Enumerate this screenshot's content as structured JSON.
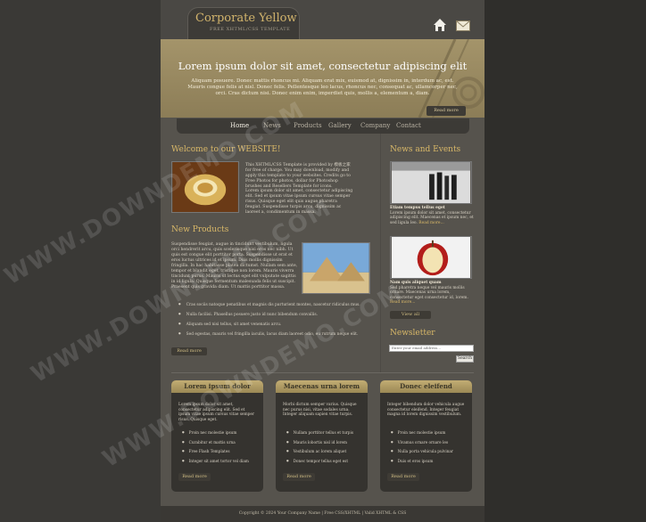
{
  "header": {
    "logo_title": "Corporate Yellow",
    "logo_subtitle": "FREE XHTML/CSS TEMPLATE"
  },
  "hero": {
    "title": "Lorem ipsum dolor sit amet, consectetur adipiscing elit",
    "text": "Aliquam posuere. Donec mattis rhoncus mi. Aliquam erat mix, euismod at, dignissim in, interdum ac, est. Mauris congue felis at nisl. Donec felis. Pellentesque leo lacus, rhoncus nec, consequat ac, ullamcorper nec, orci. Cras dictum nisi. Donec enim enim, imperdiet quis, mollis a, elementum a, diam.",
    "button": "Read more"
  },
  "nav": {
    "items": [
      "Home",
      "News",
      "Products",
      "Gallery",
      "Company",
      "Contact"
    ]
  },
  "welcome": {
    "heading": "Welcome to our WEBSITE!",
    "text": "This XHTML/CSS Template is provided by 模板之家 for free of charge. You may download, modify and apply this template to your websites. Credits go to Free Photos for photos, dollar for Photoshop brushes and Resellers Template for icons.",
    "text2": "Lorem ipsum dolor sit amet, consectetur adipiscing elit. Sed et ipsum vitae ipsum cursus vitae semper risus. Quisque eget elit quis augue pharetra feugiat. Suspendisse turpis arcu, dignissim ac laoreet a, condimentum in massa."
  },
  "products": {
    "heading": "New Products",
    "text": "Suspendisse feugiat, augue in tincidunt vestibulum, ligula orci hendrerit arcu, quis scelerisque nisi eros nec nibh. Ut quis est congue elit porttitor porta. Suspendisse ut erat et eros luctus ultrices id et ipsum. Duis mollis dignissim fringilla. In hac habitasse platea dictumst. Nullam sem ante, tempor et blandit eget, tristique non lorem. Mauris viverra tincidunt purus. Mauris ut lectus eget elit vulputate sagittis in id ligula. Quisque fermentum malesuada felis ut suscipit. Praesent quis gravida diam. Ut mattis porttitor massa.",
    "bullets": [
      "Cras sociis natoque penatibus et magnis dis parturient montes, nascetur ridiculus mus.",
      "Nulla facilisi. Phasellus posuere justo id nunc bibendum convallis.",
      "Aliquam sed nisi tellus, sit amet venenatis arcu.",
      "Sed egestas, mauris vel fringilla iaculis, lacus diam laoreet odio, eu rutrum neque elit."
    ],
    "button": "Read more"
  },
  "news": {
    "heading": "News and Events",
    "item1_title": "Etiam tempus tellus eget",
    "item1_text": "Lorem ipsum dolor sit amet, consectetur adipiscing elit. Maecenas et ipsum nec, et sed ligula leo.",
    "item1_link": "Read more...",
    "item2_title": "Nam quis aliquet quam",
    "item2_text": "Sed pharetra neque vel mauris mollis ornare. Maecenas urna lorem, consectetur eget consectetur id, lorem.",
    "item2_link": "Read more...",
    "view_all": "View all"
  },
  "newsletter": {
    "heading": "Newsletter",
    "placeholder": "Enter your email address...",
    "button": "Search"
  },
  "boxes": [
    {
      "title": "Lorem ipsum dolor",
      "text": "Lorem ipsum dolor sit amet, consectetur adipiscing elit. Sed et ipsum vitae ipsum cursus vitae semper risus. Quisque eget.",
      "items": [
        "Proin nec molestie ipsum",
        "Curabitur et mattis urna",
        "Free Flash Templates",
        "Integer sit amet tortor vel diam"
      ],
      "button": "Read more"
    },
    {
      "title": "Maecenas urna lorem",
      "text": "Morbi dictum semper varius. Quisque nec purus nisi, vitae sodales urna. Integer aliquam sapien vitae turpis.",
      "items": [
        "Nullam porttitor tellus et turpis",
        "Mauris lobortis nisl id lorem",
        "Vestibulum ac lorem aliquet",
        "Donec tempor tellus eget est"
      ],
      "button": "Read more"
    },
    {
      "title": "Donec eleifend",
      "text": "Integer bibendum dolor vehicula augue consectetur eleifend. Integer feugiat magna id lorem dignissim vestibulum.",
      "items": [
        "Proin nec molestie ipsum",
        "Vivamus ornare ornare leo",
        "Nulla porta vehicula pulvinar",
        "Duis et eros ipsum"
      ],
      "button": "Read more"
    }
  ],
  "footer": {
    "text": "Copyright © 2024 Your Company Name | Free CSS/XHTML | Valid XHTML & CSS"
  },
  "watermark": {
    "text": "WWW.DOWNDEMO.COM"
  },
  "colors": {
    "accent": "#d9b868",
    "background": "#56534d",
    "hero": "#a4946a"
  }
}
